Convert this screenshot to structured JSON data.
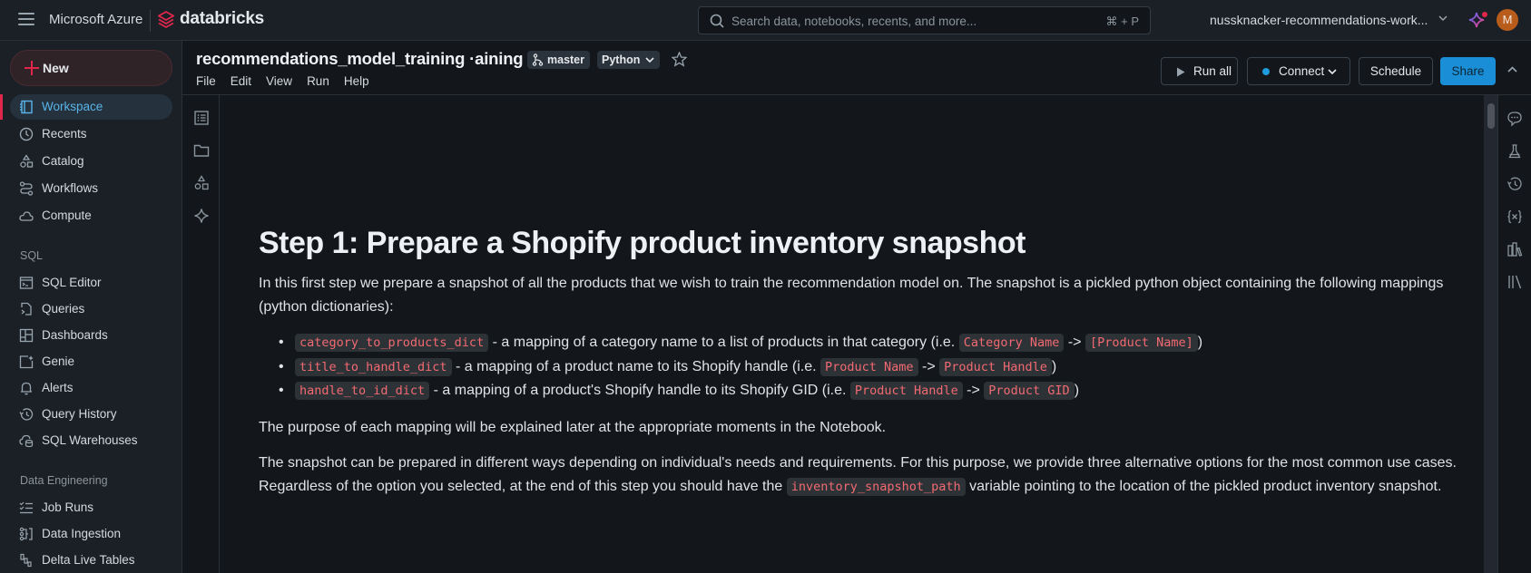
{
  "topbar": {
    "cloud_label": "Microsoft Azure",
    "brand_name": "databricks",
    "search_placeholder": "Search data, notebooks, recents, and more...",
    "search_shortcut": "⌘ + P",
    "workspace_name": "nussknacker-recommendations-work...",
    "avatar_initial": "M",
    "colors": {
      "brand_red": "#e0264a",
      "avatar": "#b85c1c"
    }
  },
  "sidebar": {
    "new_label": "New",
    "main_items": [
      {
        "label": "Workspace",
        "icon": "workspace-icon",
        "active": true
      },
      {
        "label": "Recents",
        "icon": "clock-icon"
      },
      {
        "label": "Catalog",
        "icon": "catalog-icon"
      },
      {
        "label": "Workflows",
        "icon": "workflows-icon"
      },
      {
        "label": "Compute",
        "icon": "cloud-icon"
      }
    ],
    "sql_section": "SQL",
    "sql_items": [
      {
        "label": "SQL Editor",
        "icon": "sql-editor-icon"
      },
      {
        "label": "Queries",
        "icon": "queries-icon"
      },
      {
        "label": "Dashboards",
        "icon": "dashboards-icon"
      },
      {
        "label": "Genie",
        "icon": "genie-icon"
      },
      {
        "label": "Alerts",
        "icon": "bell-icon"
      },
      {
        "label": "Query History",
        "icon": "history-icon"
      },
      {
        "label": "SQL Warehouses",
        "icon": "warehouse-icon"
      }
    ],
    "de_section": "Data Engineering",
    "de_items": [
      {
        "label": "Job Runs",
        "icon": "job-runs-icon"
      },
      {
        "label": "Data Ingestion",
        "icon": "ingestion-icon"
      },
      {
        "label": "Delta Live Tables",
        "icon": "dlt-icon"
      }
    ]
  },
  "notebook": {
    "title": "recommendations_model_training ·aining",
    "branch": "master",
    "language": "Python",
    "menu": [
      "File",
      "Edit",
      "View",
      "Run",
      "Help"
    ],
    "toolbar": {
      "run_all": "Run all",
      "connect": "Connect",
      "schedule": "Schedule",
      "share": "Share"
    },
    "colors": {
      "share": "#1a8fd8",
      "connect_dot": "#1d9bde"
    }
  },
  "cell": {
    "heading": "Step 1: Prepare a Shopify product inventory snapshot",
    "intro": "In this first step we prepare a snapshot of all the products that we wish to train the recommendation model on. The snapshot is a pickled python object containing the following mappings (python dictionaries):",
    "bullets": [
      {
        "code": "category_to_products_dict",
        "text": " - a mapping of a category name to a list of products in that category (i.e. ",
        "from": "Category Name",
        "arrow": " -> ",
        "to": "[Product Name]",
        "close": ")"
      },
      {
        "code": "title_to_handle_dict",
        "text": " - a mapping of a product name to its Shopify handle (i.e. ",
        "from": "Product Name",
        "arrow": " -> ",
        "to": "Product Handle",
        "close": ")"
      },
      {
        "code": "handle_to_id_dict",
        "text": " - a mapping of a product's Shopify handle to its Shopify GID (i.e. ",
        "from": "Product Handle",
        "arrow": " -> ",
        "to": "Product GID",
        "close": ")"
      }
    ],
    "purpose": "The purpose of each mapping will be explained later at the appropriate moments in the Notebook.",
    "options_pre": "The snapshot can be prepared in different ways depending on individual's needs and requirements. For this purpose, we provide three alternative options for the most common use cases. Regardless of the option you selected, at the end of this step you should have the ",
    "options_code": "inventory_snapshot_path",
    "options_post": " variable pointing to the location of the pickled product inventory snapshot."
  }
}
